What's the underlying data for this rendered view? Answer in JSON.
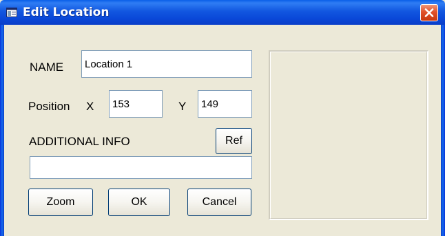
{
  "window": {
    "title": "Edit Location",
    "icons": {
      "app": "app-window-icon",
      "close": "close-x-icon"
    },
    "colors": {
      "titlebar": "#0a48d8",
      "close_button": "#e0502a",
      "face": "#ece9d8"
    }
  },
  "form": {
    "name_label": "NAME",
    "name_value": "Location 1",
    "position_label": "Position",
    "x_label": "X",
    "x_value": "153",
    "y_label": "Y",
    "y_value": "149",
    "additional_info_label": "ADDITIONAL INFO",
    "additional_info_value": ""
  },
  "buttons": {
    "ref": "Ref",
    "zoom": "Zoom",
    "ok": "OK",
    "cancel": "Cancel"
  }
}
